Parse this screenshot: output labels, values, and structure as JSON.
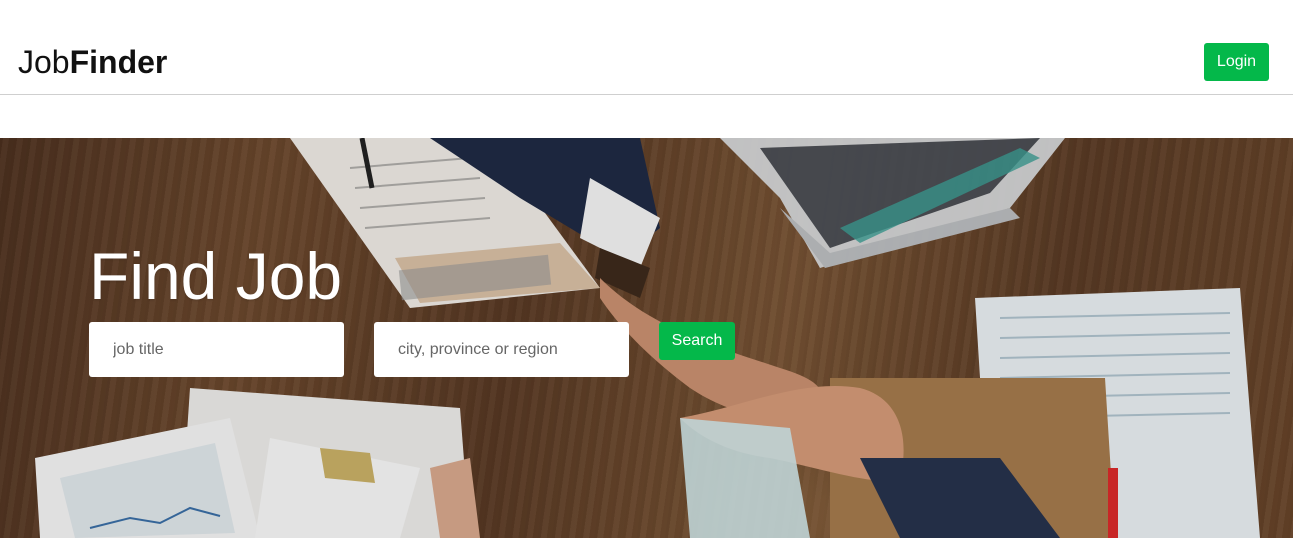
{
  "header": {
    "brand_light": "Job",
    "brand_bold": "Finder",
    "login_label": "Login"
  },
  "hero": {
    "title": "Find Job",
    "job_placeholder": "job title",
    "location_placeholder": "city, province or region",
    "search_label": "Search",
    "background_image": "business-handshake-photo"
  },
  "colors": {
    "accent": "#04b84a",
    "text_dark": "#111111",
    "hero_text": "#ffffff"
  }
}
